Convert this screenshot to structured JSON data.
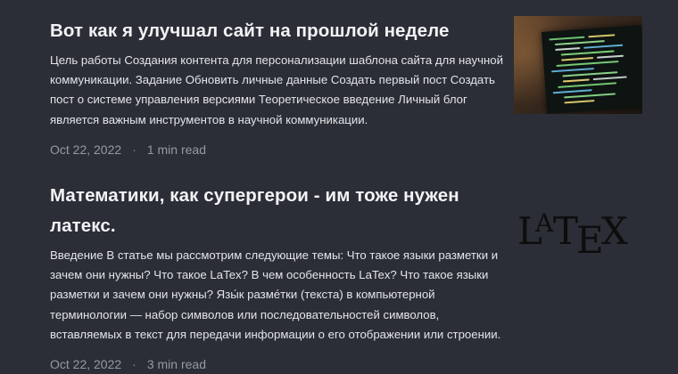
{
  "posts": [
    {
      "title": "Вот как я улучшал сайт на прошлой неделе",
      "excerpt": "Цель работы Создания контента для персонализации шаблона сайта для научной коммуникации. Задание Обновить личные данные Создать первый пост Создать пост о системе управления версиями Теоретическое введение Личный блог является важным инструментов в научной коммуникации.",
      "date": "Oct 22, 2022",
      "separator": "·",
      "read_time": "1 min read",
      "thumbnail_icon": "code-screen-image"
    },
    {
      "title": "Математики, как супергерои - им тоже нужен латекс.",
      "excerpt": "Введение В статье мы рассмотрим следующие темы: Что такое языки разметки и зачем они нужны? Что такое LaTex? В чем особенность LaTex? Что такое языки разметки и зачем они нужны? Язы́к разме́тки (текста) в компьютерной терминологии — набор символов или последовательностей символов, вставляемых в текст для передачи информации о его отображении или строении.",
      "date": "Oct 22, 2022",
      "separator": "·",
      "read_time": "3 min read",
      "thumbnail_icon": "latex-logo"
    }
  ],
  "colors": {
    "background": "#2b2e36",
    "title": "#f2f3f6",
    "excerpt": "#e3e5ea",
    "meta": "#9599a4"
  }
}
